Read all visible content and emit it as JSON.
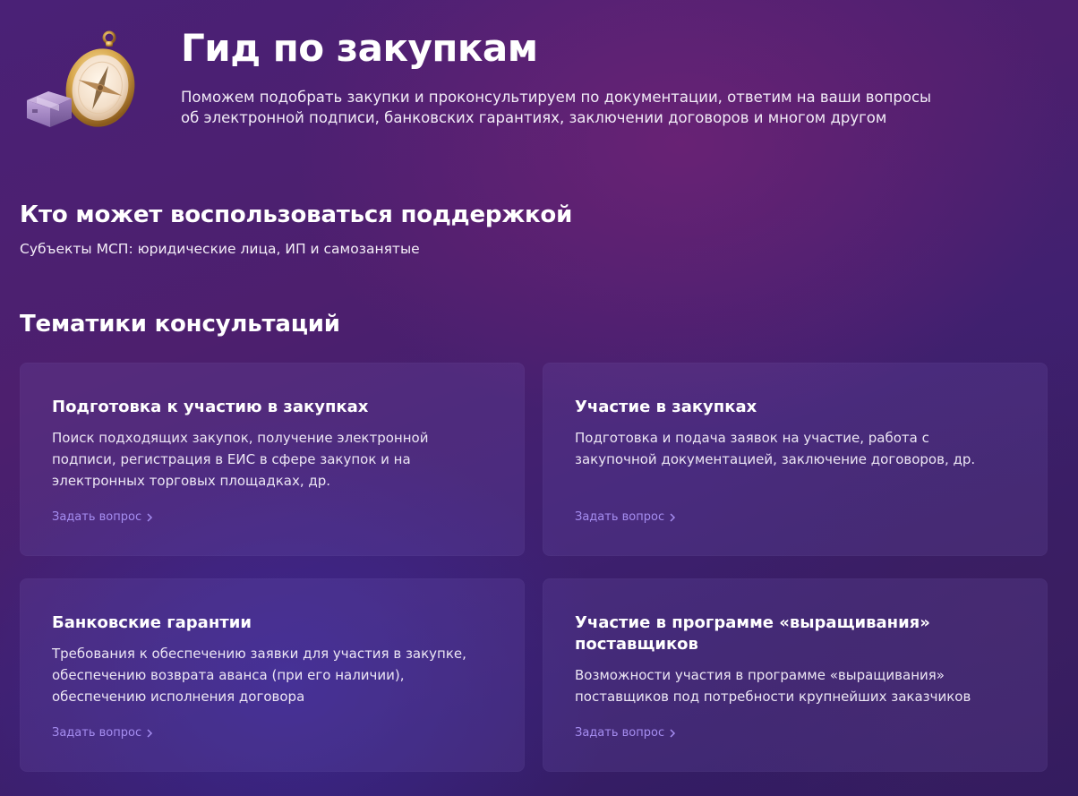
{
  "hero": {
    "title": "Гид по закупкам",
    "description": "Поможем подобрать закупки и проконсультируем по документации, ответим на ваши вопросы об электронной подписи, банковских гарантиях, заключении договоров и многом другом",
    "illustration_icon": "compass-and-box-icon"
  },
  "support": {
    "title": "Кто может воспользоваться поддержкой",
    "subtitle": "Субъекты МСП: юридические лица, ИП и самозанятые"
  },
  "topics": {
    "title": "Тематики консультаций",
    "cards": [
      {
        "title": "Подготовка к участию в закупках",
        "text": "Поиск подходящих закупок, получение электронной подписи, регистрация в ЕИС в сфере закупок и на электронных торговых площадках, др.",
        "link": "Задать вопрос"
      },
      {
        "title": "Участие в закупках",
        "text": "Подготовка и подача заявок на участие, работа с закупочной документацией, заключение договоров, др.",
        "link": "Задать вопрос"
      },
      {
        "title": "Банковские гарантии",
        "text": "Требования к обеспечению заявки для участия в закупке, обеспечению возврата аванса (при его наличии), обеспечению исполнения договора",
        "link": "Задать вопрос"
      },
      {
        "title": "Участие в программе «выращивания» поставщиков",
        "text": "Возможности участия в программе «выращивания» поставщиков под потребности крупнейших заказчиков",
        "link": "Задать вопрос"
      }
    ]
  },
  "colors": {
    "background": "#4a2176",
    "card": "#5b3f8f",
    "link": "#a58df0",
    "text": "#ffffff"
  }
}
